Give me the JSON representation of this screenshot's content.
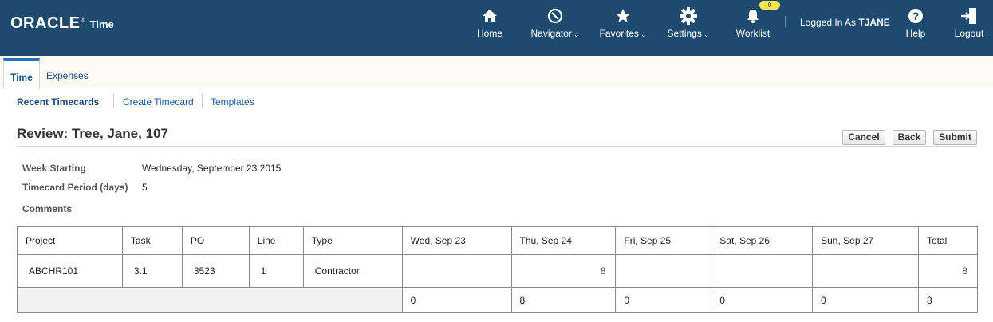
{
  "brand": {
    "logo": "ORACLE",
    "trademark": "®",
    "app": "Time"
  },
  "header_nav": [
    {
      "label": "Home",
      "icon": "home-icon",
      "caret": false
    },
    {
      "label": "Navigator",
      "icon": "compass-icon",
      "caret": true
    },
    {
      "label": "Favorites",
      "icon": "star-icon",
      "caret": true
    },
    {
      "label": "Settings",
      "icon": "gear-icon",
      "caret": true
    },
    {
      "label": "Worklist",
      "icon": "bell-icon",
      "caret": false,
      "badge": "0"
    },
    {
      "label": "Help",
      "icon": "help-icon",
      "caret": false
    },
    {
      "label": "Logout",
      "icon": "logout-icon",
      "caret": false
    }
  ],
  "user": {
    "prefix": "Logged In As",
    "name": "TJANE"
  },
  "tabs": [
    {
      "label": "Time",
      "active": true
    },
    {
      "label": "Expenses",
      "active": false
    }
  ],
  "subnav": [
    {
      "label": "Recent Timecards",
      "current": true
    },
    {
      "label": "Create Timecard",
      "current": false
    },
    {
      "label": "Templates",
      "current": false
    }
  ],
  "page": {
    "title": "Review: Tree, Jane, 107"
  },
  "actions": {
    "cancel": "Cancel",
    "back": "Back",
    "submit": "Submit"
  },
  "fields": {
    "week_starting": {
      "label": "Week Starting",
      "value": "Wednesday, September 23 2015"
    },
    "period": {
      "label": "Timecard Period (days)",
      "value": "5"
    },
    "comments": {
      "label": "Comments",
      "value": ""
    }
  },
  "table": {
    "headers": [
      "Project",
      "Task",
      "PO",
      "Line",
      "Type",
      "Wed, Sep 23",
      "Thu, Sep 24",
      "Fri, Sep 25",
      "Sat, Sep 26",
      "Sun, Sep 27",
      "Total"
    ],
    "row": [
      "ABCHR101",
      "3.1",
      "3523",
      "1",
      "Contractor",
      "",
      "8",
      "",
      "",
      "",
      "8"
    ],
    "totals": [
      "0",
      "8",
      "0",
      "0",
      "0",
      "8"
    ]
  },
  "colors": {
    "header_bg": "#1f4a6f",
    "link": "#1c5ea8",
    "badge": "#f6e35a"
  }
}
